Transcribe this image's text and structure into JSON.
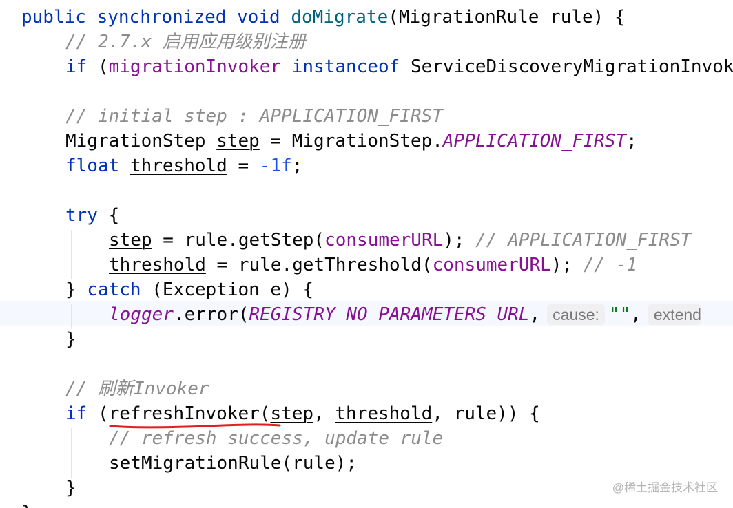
{
  "code": {
    "l1": {
      "kw_public": "public",
      "kw_synchronized": "synchronized",
      "kw_void": "void",
      "method": "doMigrate",
      "params": "(MigrationRule rule) {"
    },
    "l2": {
      "comment": "// 2.7.x 启用应用级别注册"
    },
    "l3": {
      "kw_if": "if",
      "open": " (",
      "field": "migrationInvoker",
      "kw_instanceof": "instanceof",
      "type": "ServiceDiscoveryMigrationInvoker"
    },
    "l5": {
      "comment": "// initial step : APPLICATION_FIRST"
    },
    "l6": {
      "type": "MigrationStep",
      "var": "step",
      "assign": " = MigrationStep.",
      "const": "APPLICATION_FIRST",
      "end": ";"
    },
    "l7": {
      "kw_float": "float",
      "var": "threshold",
      "assign": " = ",
      "number": "-1f",
      "end": ";"
    },
    "l9": {
      "kw_try": "try",
      "brace": " {"
    },
    "l10": {
      "var": "step",
      "call": " = rule.getStep(",
      "field": "consumerURL",
      "close": ");",
      "comment": "// APPLICATION_FIRST"
    },
    "l11": {
      "var": "threshold",
      "call": " = rule.getThreshold(",
      "field": "consumerURL",
      "close": ");",
      "comment": "// -1"
    },
    "l12": {
      "close": "} ",
      "kw_catch": "catch",
      "rest": " (Exception e) {"
    },
    "l13": {
      "field": "logger",
      "call": ".error(",
      "const": "REGISTRY_NO_PARAMETERS_URL",
      "comma": ",",
      "hint_cause": "cause:",
      "string": "\"\"",
      "comma2": ",",
      "hint_extend": "extend"
    },
    "l14": {
      "close": "}"
    },
    "l16": {
      "comment": "// 刷新Invoker"
    },
    "l17": {
      "kw_if": "if",
      "open": " (",
      "method": "refreshInvoker",
      "paren": "(",
      "var1": "step",
      "sep": ", ",
      "var2": "threshold",
      "rest": ", rule)) {"
    },
    "l18": {
      "comment": "// refresh success, update rule"
    },
    "l19": {
      "stmt": "setMigrationRule(rule);"
    },
    "l20": {
      "close": "}"
    },
    "l21": {
      "close": "}"
    }
  },
  "colors": {
    "keyword": "#0033b3",
    "method": "#00627a",
    "field": "#871094",
    "number": "#1750eb",
    "string": "#067d17",
    "comment": "#8c8c8c",
    "annotation_mark": "#e02020"
  },
  "watermark": "@稀土掘金技术社区"
}
